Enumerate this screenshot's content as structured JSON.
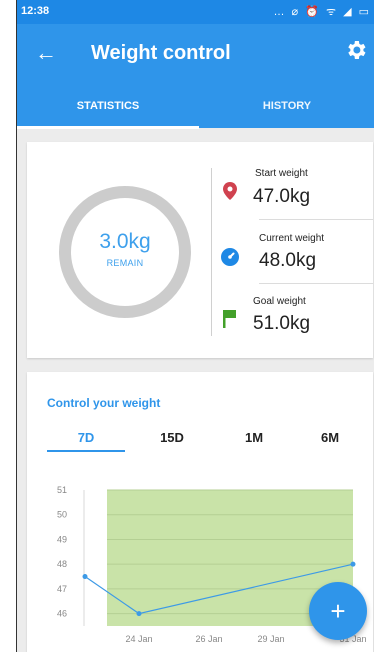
{
  "status_bar": {
    "time": "12:38",
    "icons": "… ⌀ ⏰ ᯤ ◢ ▭"
  },
  "app_bar": {
    "title": "Weight control",
    "tabs": [
      "STATISTICS",
      "HISTORY"
    ],
    "active_tab": "STATISTICS",
    "color": "#2f95ea"
  },
  "summary": {
    "remain_value": "3.0kg",
    "remain_label": "REMAIN",
    "start": {
      "label": "Start weight",
      "value": "47.0kg",
      "icon": "location-pin-icon",
      "color": "#d0424f"
    },
    "current": {
      "label": "Current weight",
      "value": "48.0kg",
      "icon": "gauge-icon",
      "color": "#1e88e5"
    },
    "goal": {
      "label": "Goal weight",
      "value": "51.0kg",
      "icon": "flag-icon",
      "color": "#43a02a"
    }
  },
  "control": {
    "title": "Control your weight",
    "ranges": [
      "7D",
      "15D",
      "1M",
      "6M"
    ],
    "active_range": "7D"
  },
  "chart_data": {
    "type": "line",
    "x": [
      "22 Jan",
      "24 Jan",
      "31 Jan"
    ],
    "x_ticks": [
      "24 Jan",
      "26 Jan",
      "29 Jan",
      "31 Jan"
    ],
    "values": [
      47.5,
      46.0,
      48.0
    ],
    "ylim": [
      45.5,
      51
    ],
    "y_ticks": [
      46,
      47,
      48,
      49,
      50,
      51
    ],
    "goal_band": [
      45.5,
      51
    ],
    "band_color": "#c9e3a8",
    "line_color": "#3d9ae6",
    "grid": true
  }
}
